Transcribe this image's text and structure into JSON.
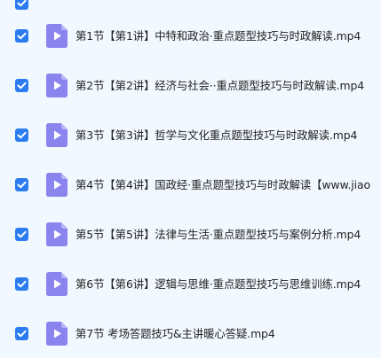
{
  "files": [
    {
      "name": "",
      "checked": true
    },
    {
      "name": "第1节【第1讲】中特和政治·重点题型技巧与时政解读.mp4",
      "checked": true
    },
    {
      "name": "第2节【第2讲】经济与社会··重点题型技巧与时政解读.mp4",
      "checked": true
    },
    {
      "name": "第3节【第3讲】哲学与文化重点题型技巧与时政解读.mp4",
      "checked": true
    },
    {
      "name": "第4节【第4讲】国政经·重点题型技巧与时政解读【www.jiao",
      "checked": true
    },
    {
      "name": "第5节【第5讲】法律与生活·重点题型技巧与案例分析.mp4",
      "checked": true
    },
    {
      "name": "第6节【第6讲】逻辑与思维·重点题型技巧与思维训练.mp4",
      "checked": true
    },
    {
      "name": "第7节 考场答题技巧&主讲暖心答疑.mp4",
      "checked": true
    }
  ],
  "icons": {
    "checkbox": "checkbox-checked-icon",
    "file": "video-file-icon"
  },
  "colors": {
    "background": "#f2f8ff",
    "checkbox": "#2b7cf0",
    "file_icon": "#8a84ef",
    "file_icon_fold": "#b9b5f7",
    "text": "#222222"
  }
}
